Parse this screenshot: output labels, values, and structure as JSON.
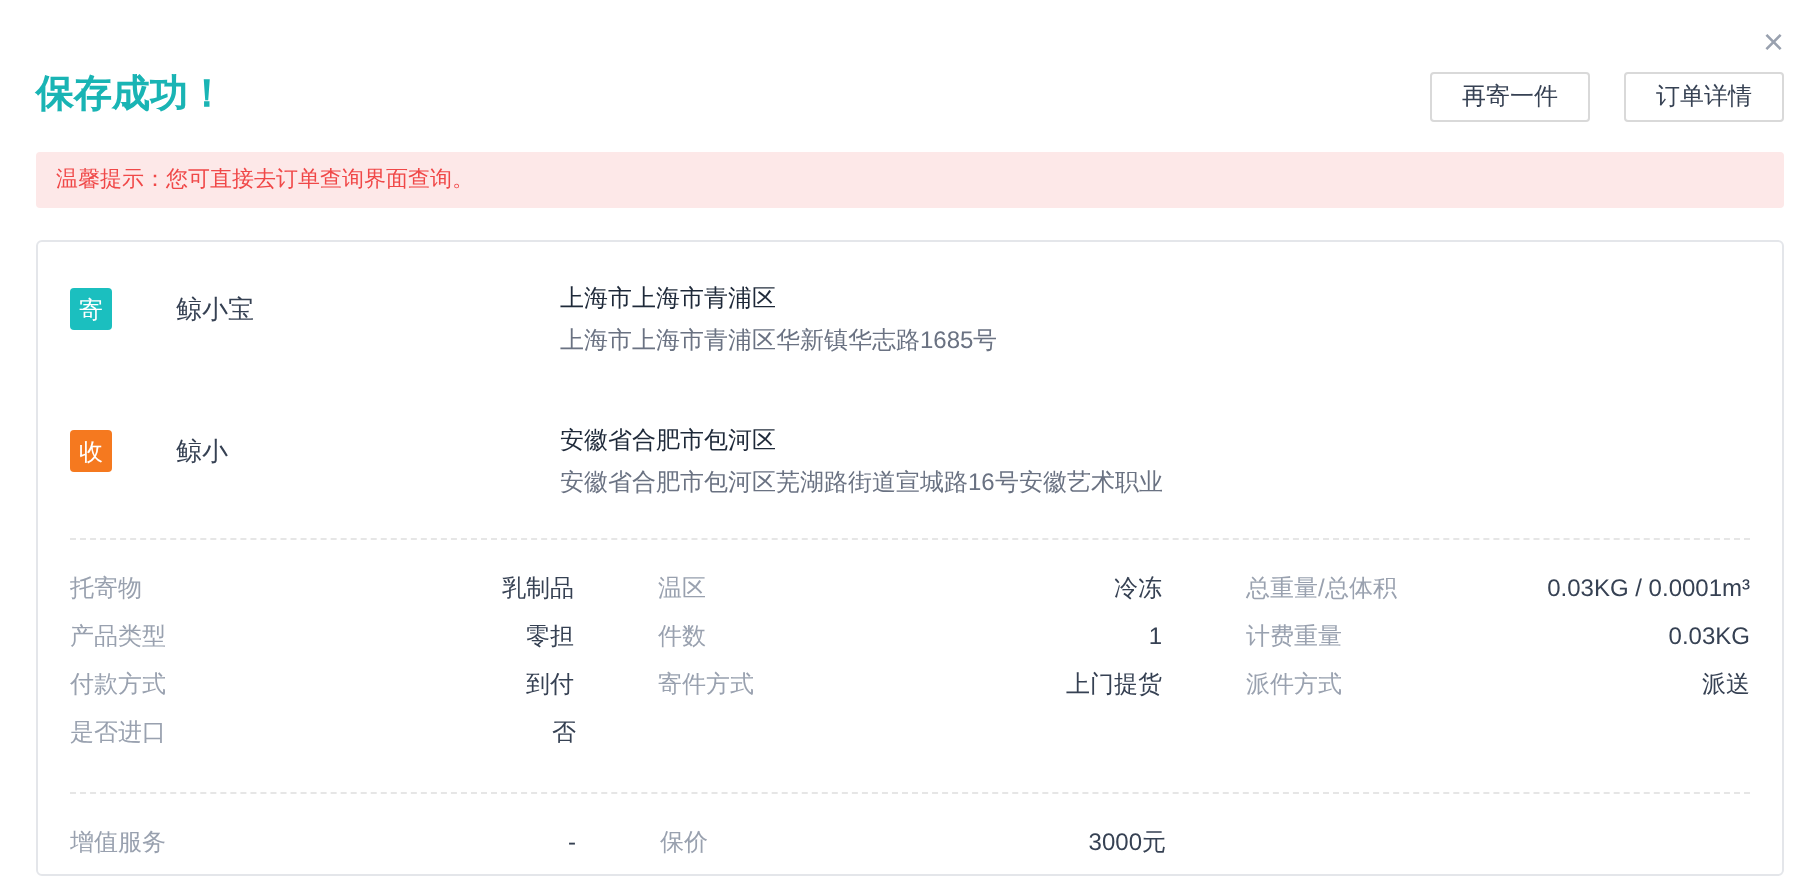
{
  "title": "保存成功！",
  "close": "×",
  "buttons": [
    "再寄一件",
    "订单详情"
  ],
  "notice": "温馨提示：您可直接去订单查询界面查询。",
  "parties": [
    {
      "badge": "寄",
      "color": "#1bbfbf",
      "name": "鲸小宝",
      "region": "上海市上海市青浦区",
      "address": "上海市上海市青浦区华新镇华志路1685号"
    },
    {
      "badge": "收",
      "color": "#f5791f",
      "name": "鲸小",
      "region": "安徽省合肥市包河区",
      "address": "安徽省合肥市包河区芜湖路街道宣城路16号安徽艺术职业"
    }
  ],
  "details": [
    [
      {
        "label": "托寄物",
        "value": "乳制品"
      },
      {
        "label": "温区",
        "value": "冷冻"
      },
      {
        "label": "总重量/总体积",
        "value": "0.03KG / 0.0001m³"
      }
    ],
    [
      {
        "label": "产品类型",
        "value": "零担"
      },
      {
        "label": "件数",
        "value": "1"
      },
      {
        "label": "计费重量",
        "value": "0.03KG"
      }
    ],
    [
      {
        "label": "付款方式",
        "value": "到付"
      },
      {
        "label": "寄件方式",
        "value": "上门提货"
      },
      {
        "label": "派件方式",
        "value": "派送"
      }
    ],
    [
      {
        "label": "是否进口",
        "value": "否"
      }
    ]
  ],
  "services": [
    {
      "label": "增值服务",
      "value": "-"
    },
    {
      "label": "保价",
      "value": "3000元"
    }
  ]
}
